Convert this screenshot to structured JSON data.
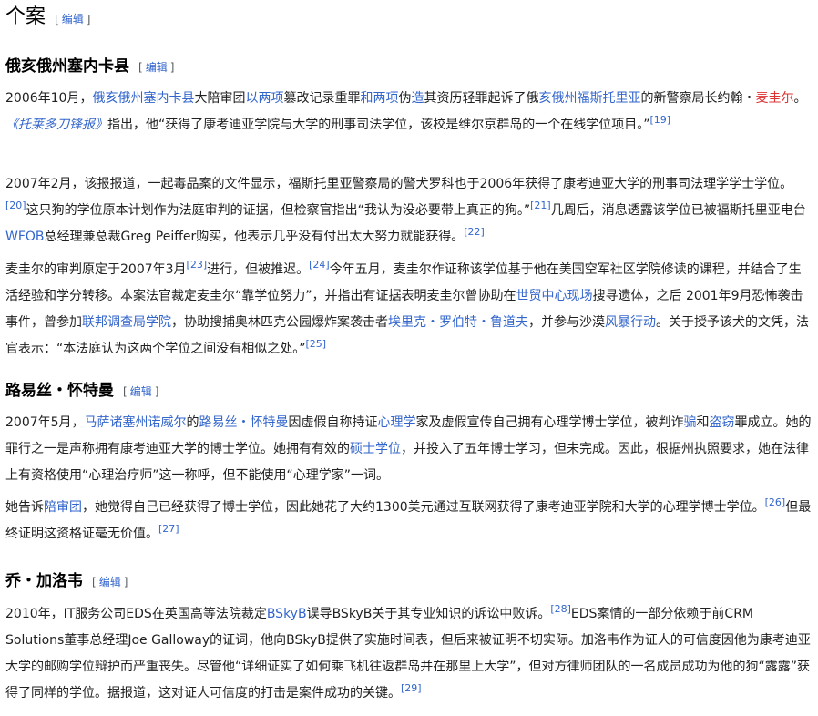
{
  "title": "个案",
  "edit_label": "编辑",
  "sections": [
    {
      "heading": "俄亥俄州塞内卡县",
      "p1": {
        "t1": "2006年10月，",
        "l1": "俄亥俄州塞内卡县",
        "t2": "大陪审团",
        "l2": "以两项",
        "t3": "篡改记录重罪",
        "l3": "和两项",
        "t4": "伪",
        "l4": "造",
        "t5": "其资历轻罪起诉了俄",
        "l5": "亥俄州福斯托里亚",
        "t6": "的新警察局长约翰・",
        "l6": "麦圭尔",
        "t7": "。",
        "l7": "《托莱多刀锋报》",
        "t8": "指出，他“获得了康考迪亚学院与大学的刑事司法学位，该校是维尔京群岛的一个在线学位项目。”",
        "r1": "[19]"
      },
      "p2": {
        "t1": "2007年2月，该报报道，一起毒品案的文件显示，福斯托里亚警察局的警犬罗科也于2006年获得了康考迪亚大学的刑事司法理学学士学位。",
        "r1": "[20]",
        "t2": "这只狗的学位原本计划作为法庭审判的证据，但检察官指出“我认为没必要带上真正的狗。”",
        "r2": "[21]",
        "t3": "几周后，消息透露该学位已被福斯托里亚电台",
        "l1": "WFOB",
        "t4": "总经理兼总裁Greg Peiffer购买，他表示几乎没有付出太大努力就能获得。",
        "r3": "[22]"
      },
      "p3": {
        "t1": "麦圭尔的审判原定于2007年3月",
        "r1": "[23]",
        "t2": "进行，但被推迟。",
        "r2": "[24]",
        "t3": "今年五月，麦圭尔作证称该学位基于他在美国空军社区学院修读的课程，并结合了生活经验和学分转移。本案法官裁定麦圭尔“靠学位努力”，并指出有证据表明麦圭尔曾协助在",
        "l1": "世贸中心现场",
        "t4": "搜寻遗体，之后 2001年9月恐怖袭击事件，曾参加",
        "l2": "联邦调查局学院",
        "t5": "，协助搜捕奥林匹克公园爆炸案袭击者",
        "l3": "埃里克・罗伯特・鲁道夫",
        "t6": "，并参与沙漠",
        "l4": "风暴行动",
        "t7": "。关于授予该犬的文凭，法官表示：“本法庭认为这两个学位之间没有相似之处。”",
        "r3": "[25]"
      }
    },
    {
      "heading": "路易丝・怀特曼",
      "p1": {
        "t1": "2007年5月，",
        "l1": "马萨诸塞州诺威尔",
        "t2": "的",
        "l2": "路易丝・怀特曼",
        "t3": "因虚假自称持证",
        "l3": "心理学",
        "t4": "家及虚假宣传自己拥有心理学博士学位，被判诈",
        "l4": "骗",
        "t5": "和",
        "l5": "盗窃",
        "t6": "罪成立。她的罪行之一是声称拥有康考迪亚大学的博士学位。她拥有有效的",
        "l6": "硕士学位",
        "t7": "，并投入了五年博士学习，但未完成。因此，根据州执照要求，她在法律上有资格使用“心理治疗师”这一称呼，但不能使用“心理学家”一词。"
      },
      "p2": {
        "t1": "她告诉",
        "l1": "陪审团",
        "t2": "，她觉得自己已经获得了博士学位，因此她花了大约1300美元通过互联网获得了康考迪亚学院和大学的心理学博士学位。",
        "r1": "[26]",
        "t3": "但最终证明这资格证毫无价值。",
        "r2": "[27]"
      }
    },
    {
      "heading": "乔・加洛韦",
      "p1": {
        "t1": "2010年，IT服务公司EDS在英国高等法院裁定",
        "l1": "BSkyB",
        "t2": "误导BSkyB关于其专业知识的诉讼中败诉。",
        "r1": "[28]",
        "t3": "EDS案情的一部分依赖于前CRM Solutions董事总经理Joe Galloway的证词，他向BSkyB提供了实施时间表，但后来被证明不切实际。加洛韦作为证人的可信度因他为康考迪亚大学的邮购学位辩护而严重丧失。尽管他“详细证实了如何乘飞机往返群岛并在那里上大学”，但对方律师团队的一名成员成功为他的狗“露露”获得了同样的学位。据报道，这对证人可信度的打击是案件成功的关键。",
        "r2": "[29]"
      }
    }
  ],
  "colors": {
    "link": "#3366cc",
    "redlink": "#d33",
    "text": "#202122"
  }
}
